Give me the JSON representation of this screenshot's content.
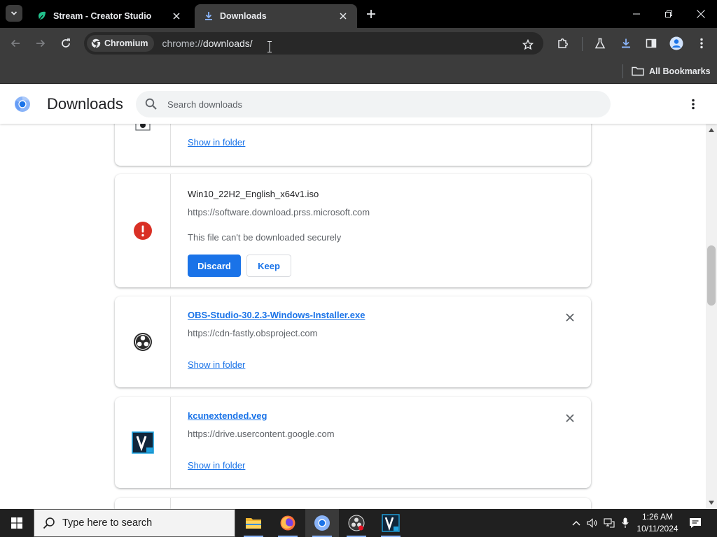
{
  "browser": {
    "tabs": [
      {
        "title": "Stream - Creator Studio",
        "active": false
      },
      {
        "title": "Downloads",
        "active": true
      }
    ],
    "site_chip": "Chromium",
    "url_scheme": "chrome://",
    "url_path": "downloads/",
    "bookmarks_label": "All Bookmarks"
  },
  "page": {
    "title": "Downloads",
    "search_placeholder": "Search downloads"
  },
  "downloads": [
    {
      "show_in_folder": "Show in folder"
    },
    {
      "name": "Win10_22H2_English_x64v1.iso",
      "url": "https://software.download.prss.microsoft.com",
      "status": "This file can't be downloaded securely",
      "discard_label": "Discard",
      "keep_label": "Keep"
    },
    {
      "name": "OBS-Studio-30.2.3-Windows-Installer.exe",
      "url": "https://cdn-fastly.obsproject.com",
      "show_in_folder": "Show in folder"
    },
    {
      "name": "kcunextended.veg",
      "url": "https://drive.usercontent.google.com",
      "show_in_folder": "Show in folder"
    }
  ],
  "taskbar": {
    "search_placeholder": "Type here to search",
    "time": "1:26 AM",
    "date": "10/11/2024"
  },
  "colors": {
    "accent": "#1a73e8",
    "warning": "#d93025",
    "chrome_dark": "#3c3c3c"
  }
}
